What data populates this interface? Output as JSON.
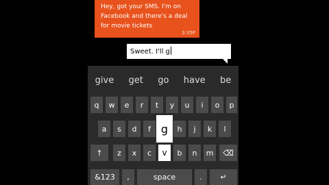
{
  "incoming": {
    "text": "Hey, got your SMS. I'm on Facebook and there's a deal for movie tickets",
    "time": "3:35P"
  },
  "outgoing": {
    "draft": "Sweet. I'll g"
  },
  "keyboard": {
    "suggestions": [
      "give",
      "get",
      "go",
      "have",
      "be"
    ],
    "row1": [
      "q",
      "w",
      "e",
      "r",
      "t",
      "y",
      "u",
      "i",
      "o",
      "p"
    ],
    "row2": [
      "a",
      "s",
      "d",
      "f",
      "g",
      "h",
      "j",
      "k",
      "l"
    ],
    "row3": {
      "shift": "↑",
      "letters": [
        "z",
        "x",
        "c",
        "v",
        "b",
        "n",
        "m"
      ],
      "backspace": "⌫"
    },
    "row4": {
      "symbols": "&123",
      "comma": ",",
      "space": "space",
      "period": ".",
      "enter": "↵"
    },
    "pressed_key": "g",
    "colors": {
      "key_bg": "#4b4b4b",
      "keyboard_bg": "#2a2a2a",
      "accent": "#e8521c"
    }
  }
}
